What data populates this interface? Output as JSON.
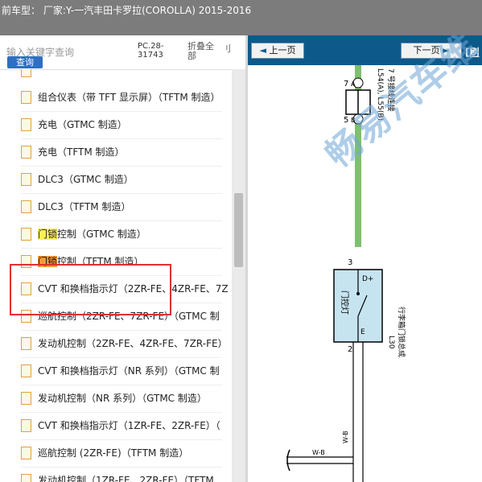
{
  "titlebar": {
    "title": "前车型：  厂家:Y-一汽丰田卡罗拉(COROLLA) 2015-2016"
  },
  "left_panel": {
    "search_placeholder": "输入关键字查询",
    "search_button": "查询",
    "page_code": [
      "PC.28-",
      "31743"
    ],
    "fold_all": [
      "折叠全",
      "部"
    ],
    "fragment": "刂",
    "items": [
      {
        "label": "组合仪表（带 TFT 显示屏）（TFTM 制造）",
        "hl": ""
      },
      {
        "label": "充电（GTMC 制造）",
        "hl": ""
      },
      {
        "label": "充电（TFTM 制造）",
        "hl": ""
      },
      {
        "label": "DLC3（GTMC 制造）",
        "hl": ""
      },
      {
        "label": "DLC3（TFTM 制造）",
        "hl": ""
      },
      {
        "label": "控制（GTMC 制造）",
        "hl": "门锁",
        "style": "yellow"
      },
      {
        "label": "控制（TFTM 制造）",
        "hl": "门锁",
        "style": "orange"
      },
      {
        "label": "CVT 和换档指示灯（2ZR-FE、4ZR-FE、7Z",
        "hl": ""
      },
      {
        "label": "巡航控制（2ZR-FE、7ZR-FE）（GTMC 制",
        "hl": ""
      },
      {
        "label": "发动机控制（2ZR-FE、4ZR-FE、7ZR-FE）",
        "hl": ""
      },
      {
        "label": "CVT 和换档指示灯（NR 系列）（GTMC 制",
        "hl": ""
      },
      {
        "label": "发动机控制（NR 系列）（GTMC 制造）",
        "hl": ""
      },
      {
        "label": "CVT 和换档指示灯（1ZR-FE、2ZR-FE）（",
        "hl": ""
      },
      {
        "label": "巡航控制 (2ZR-FE)（TFTM 制造）",
        "hl": ""
      },
      {
        "label": "发动机控制（1ZR-FE、2ZR-FE）（TFTM",
        "hl": ""
      }
    ]
  },
  "right_panel": {
    "prev_button": "上一页",
    "next_button": "下一页",
    "nav_fragment": "[刷",
    "watermark": "畅易汽车维",
    "diagram": {
      "pin_7": "7",
      "pin_A": "A",
      "pin_5": "5",
      "pin_B": "B",
      "pin_3": "3",
      "pin_2": "2",
      "label_L54_1": "L54(A), L55(B)",
      "label_L54_2": "7 号接线连接",
      "component_name": "门控灯",
      "d_plus": "D+",
      "e_pin": "E",
      "l30_1": "L30",
      "l30_2": "行李箱门锁总成",
      "wire_WB_v": "W-B",
      "wire_WB_h": "W-B"
    }
  }
}
